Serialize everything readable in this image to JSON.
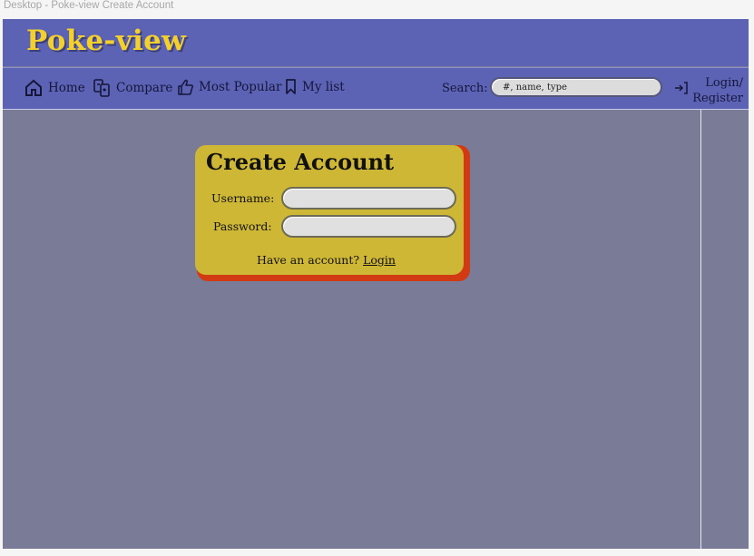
{
  "frame": {
    "title": "Desktop - Poke-view Create Account"
  },
  "header": {
    "logo": "Poke-view"
  },
  "nav": {
    "items": [
      {
        "label": "Home",
        "icon": "home-icon"
      },
      {
        "label": "Compare",
        "icon": "compare-icon"
      },
      {
        "label": "Most Popular",
        "icon": "thumbs-up-icon"
      },
      {
        "label": "My list",
        "icon": "bookmark-icon"
      }
    ],
    "search_label": "Search:",
    "search_placeholder": "#, name, type",
    "login_line1": "Login/",
    "login_line2": "Register"
  },
  "card": {
    "title": "Create Account",
    "username_label": "Username:",
    "password_label": "Password:",
    "have_account": "Have an account?",
    "login_link": "Login"
  },
  "colors": {
    "background": "#7a7b96",
    "header": "#5c63b5",
    "logo": "#f3d02c",
    "card": "#cfb736",
    "card_shadow": "#d23a14"
  }
}
